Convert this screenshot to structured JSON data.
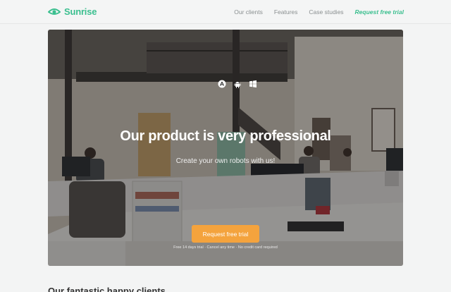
{
  "brand": {
    "name": "Sunrise",
    "accent_color": "#3bbf8f",
    "logo_icon": "sunrise-eye-icon"
  },
  "nav": {
    "links": [
      "Our clients",
      "Features",
      "Case studies"
    ],
    "cta_label": "Request free trial"
  },
  "hero": {
    "platform_icons": [
      "apple-icon",
      "android-icon",
      "windows-icon"
    ],
    "title": "Our product is very professional",
    "subtitle": "Create your own robots with us!",
    "button_label": "Request free trial",
    "button_color": "#f4a33d",
    "note": "Free 14 days trial · Cancel any time · No credit card required"
  },
  "next_section": {
    "heading": "Our fantastic happy clients"
  }
}
